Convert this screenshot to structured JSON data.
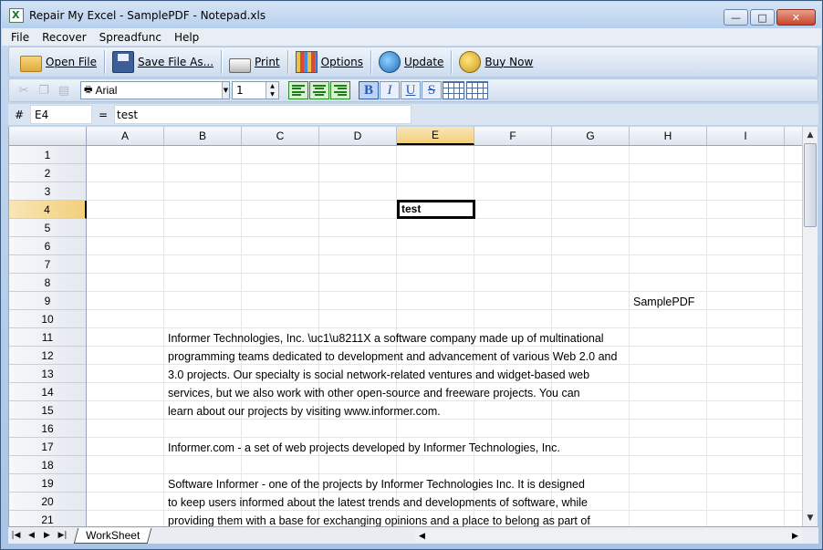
{
  "window": {
    "title": "Repair My Excel - SamplePDF - Notepad.xls",
    "minimize_glyph": "—",
    "maximize_glyph": "□",
    "close_glyph": "✕"
  },
  "menu": [
    "File",
    "Recover",
    "Spreadfunc",
    "Help"
  ],
  "toolbar": {
    "open_label": "Open File",
    "save_label": "Save File As...",
    "print_label": "Print",
    "options_label": "Options",
    "update_label": "Update",
    "buy_label": "Buy Now"
  },
  "format": {
    "font_name": "Arial",
    "font_size": "1",
    "bold": "B",
    "italic": "I",
    "underline": "U",
    "strike": "S",
    "bold_active": true
  },
  "formula": {
    "hash": "#",
    "cell_ref": "E4",
    "equals": "=",
    "value": "test"
  },
  "grid": {
    "columns": [
      "A",
      "B",
      "C",
      "D",
      "E",
      "F",
      "G",
      "H",
      "I"
    ],
    "selected_column": "E",
    "rows": [
      "1",
      "2",
      "3",
      "4",
      "5",
      "6",
      "7",
      "8",
      "9",
      "10",
      "11",
      "12",
      "13",
      "14",
      "15",
      "16",
      "17",
      "18",
      "19",
      "20",
      "21"
    ],
    "selected_row": "4",
    "active_cell_text": "test",
    "cells": {
      "H9": "SamplePDF",
      "B11": "Informer Technologies, Inc. \\uc1\\u8211X a software company made up of multinational",
      "B12": "programming teams dedicated to development and advancement of various Web 2.0 and",
      "B13": "3.0 projects. Our specialty is social network-related ventures and widget-based web",
      "B14": "services, but we also work with other open-source and freeware projects. You can",
      "B15": "learn about our projects by visiting www.informer.com.",
      "B17": "Informer.com - a set of web projects developed by Informer Technologies, Inc.",
      "B19": "Software Informer - one of the projects by Informer Technologies Inc. It is designed",
      "B20": "to keep users informed about the latest trends and developments of software, while",
      "B21": "providing them with a base for exchanging opinions and a place to belong as part of"
    }
  },
  "sheet_tab": "WorkSheet"
}
